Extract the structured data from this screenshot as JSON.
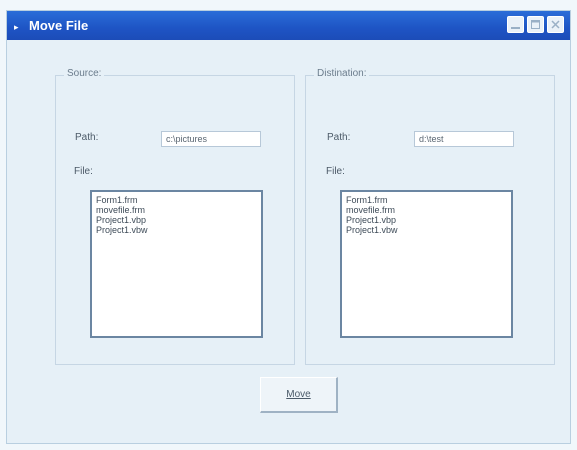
{
  "window": {
    "title": "Move File",
    "title_icon": "▸"
  },
  "source": {
    "legend": "Source:",
    "path_label": "Path:",
    "path_value": "c:\\pictures",
    "file_label": "File:",
    "files": [
      "Form1.frm",
      "movefile.frm",
      "Project1.vbp",
      "Project1.vbw"
    ]
  },
  "destination": {
    "legend": "Distination:",
    "path_label": "Path:",
    "path_value": "d:\\test",
    "file_label": "File:",
    "files": [
      "Form1.frm",
      "movefile.frm",
      "Project1.vbp",
      "Project1.vbw"
    ]
  },
  "buttons": {
    "move_label": "Move"
  },
  "colors": {
    "titlebar": "#1e54c4",
    "window_bg": "#e6f0f7",
    "listbox_border": "#6b86a2"
  },
  "icons": {
    "title": "window-menu-icon",
    "minimize": "minimize-icon",
    "maximize": "maximize-icon",
    "close": "close-icon"
  }
}
